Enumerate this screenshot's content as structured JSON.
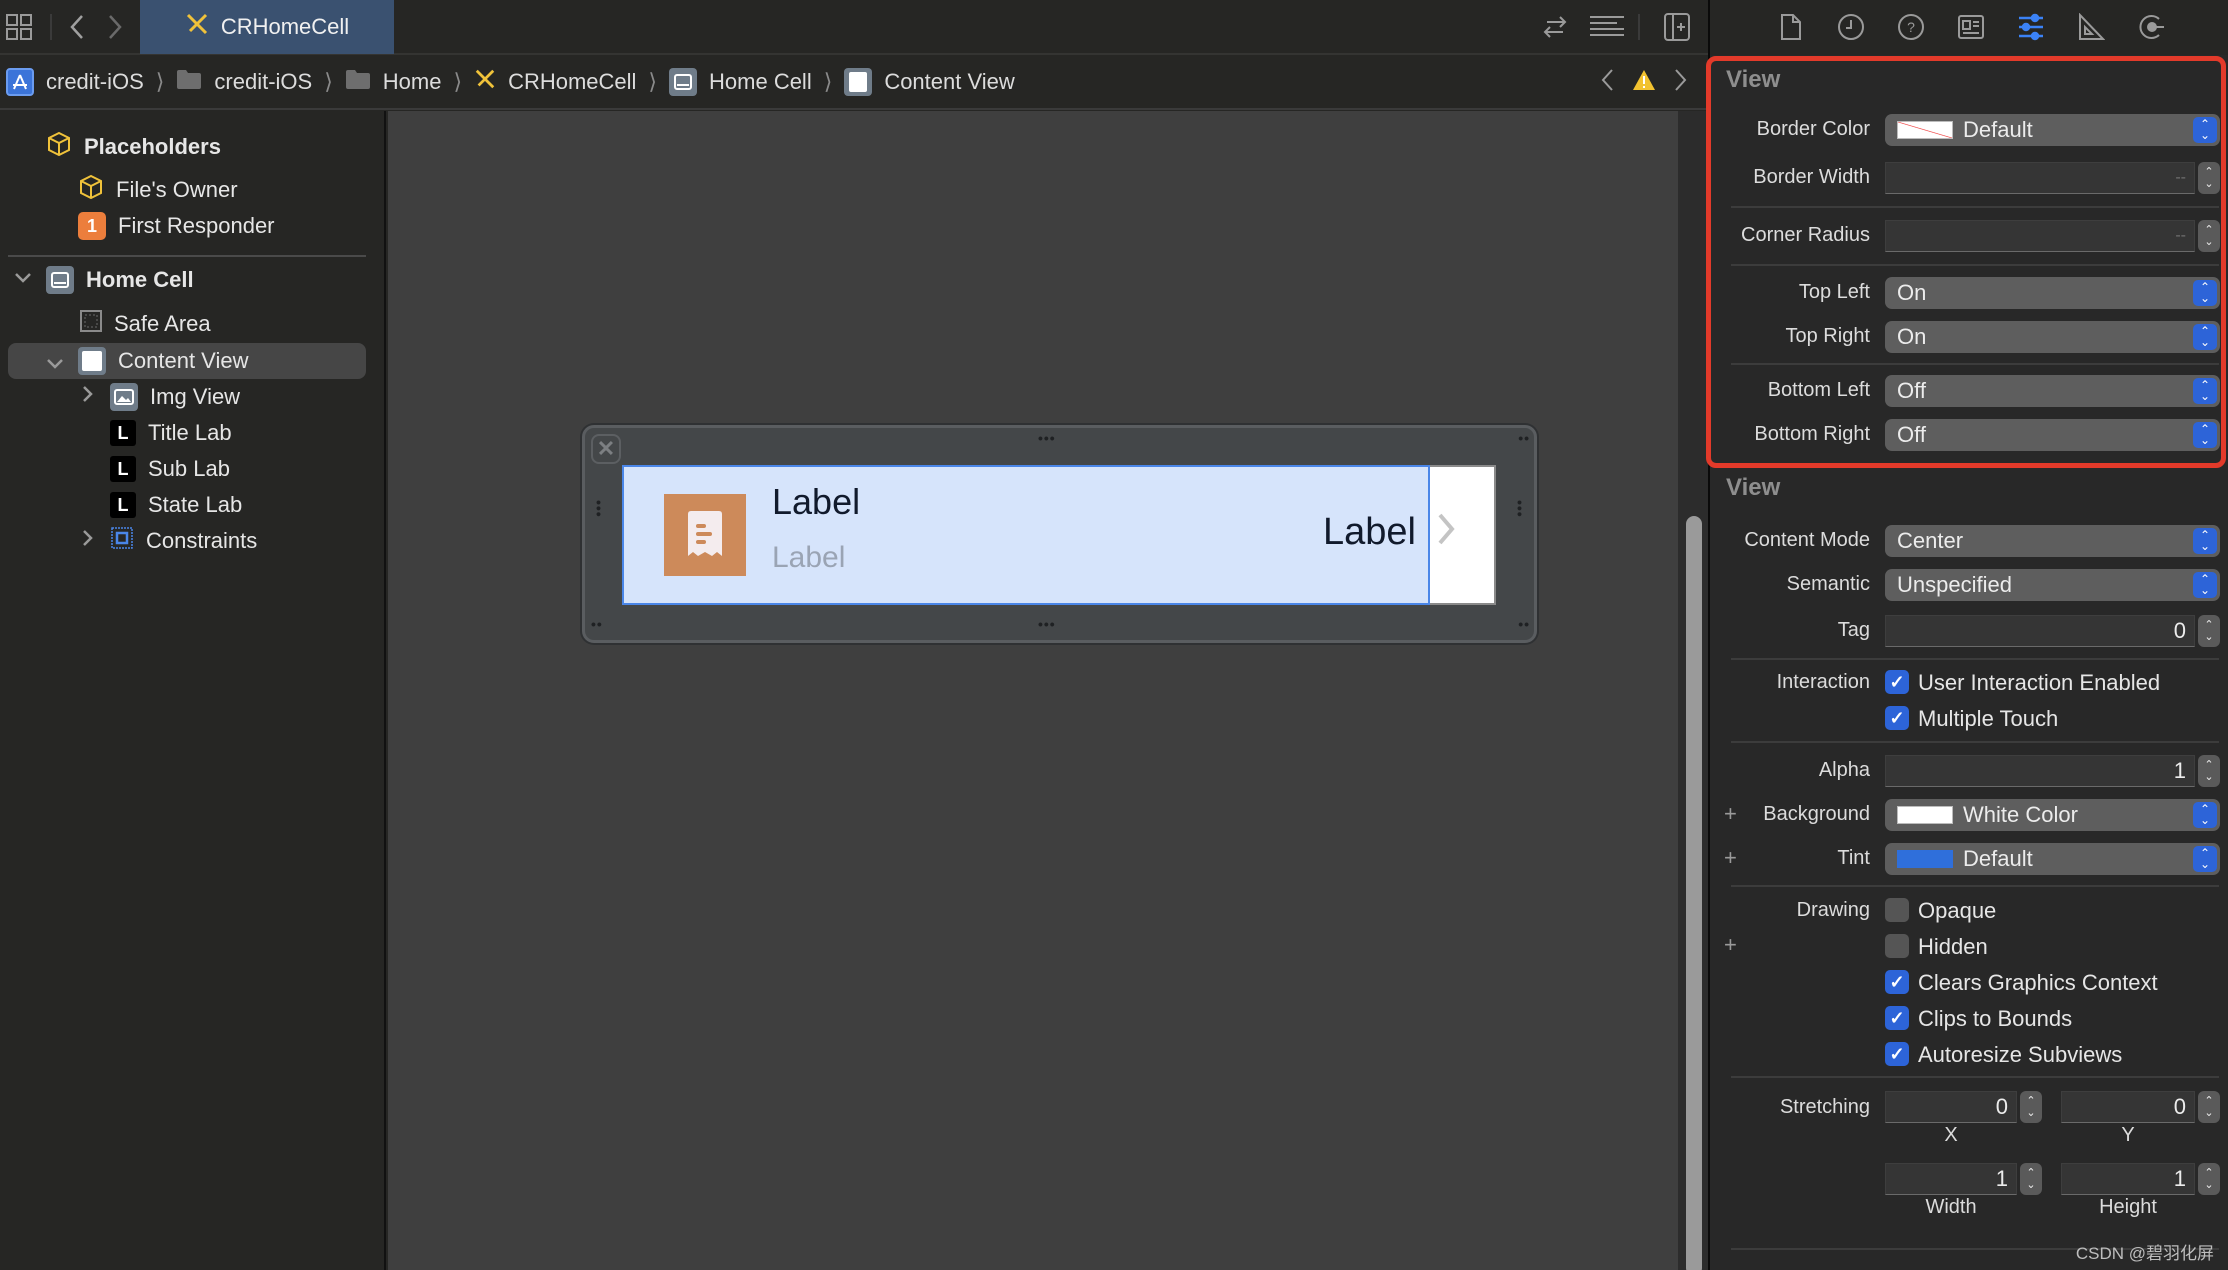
{
  "toolbar": {
    "active_tab": "CRHomeCell",
    "icons": [
      "grid-icon",
      "back-arrow-icon",
      "forward-arrow-icon",
      "swap-icon",
      "lines-icon",
      "add-editor-icon"
    ]
  },
  "breadcrumb": {
    "items": [
      {
        "label": "credit-iOS",
        "icon": "app-icon"
      },
      {
        "label": "credit-iOS",
        "icon": "folder-icon"
      },
      {
        "label": "Home",
        "icon": "folder-icon"
      },
      {
        "label": "CRHomeCell",
        "icon": "xib-icon"
      },
      {
        "label": "Home Cell",
        "icon": "table-cell-icon"
      },
      {
        "label": "Content View",
        "icon": "view-icon"
      }
    ],
    "warning_icon": "warning-icon"
  },
  "outline": {
    "placeholders_label": "Placeholders",
    "files_owner": "File's Owner",
    "first_responder": "First Responder",
    "first_responder_badge": "1",
    "home_cell": "Home Cell",
    "safe_area": "Safe Area",
    "content_view": "Content View",
    "img_view": "Img View",
    "title_lab": "Title Lab",
    "sub_lab": "Sub Lab",
    "state_lab": "State Lab",
    "constraints": "Constraints",
    "label_icon_glyph": "L"
  },
  "canvas": {
    "cell_title": "Label",
    "cell_subtitle": "Label",
    "cell_state": "Label",
    "colors": {
      "content_bg": "#d6e4fb",
      "image_bg": "#cd8a5a",
      "selection": "#4a86e8"
    }
  },
  "inspector": {
    "tabs": [
      "file-icon",
      "history-icon",
      "help-icon",
      "identity-icon",
      "attributes-icon",
      "size-icon",
      "connections-icon"
    ],
    "active_tab": "attributes-icon",
    "section1": {
      "title": "View",
      "border_color_label": "Border Color",
      "border_color_value": "Default",
      "border_width_label": "Border Width",
      "border_width_value": "--",
      "corner_radius_label": "Corner Radius",
      "corner_radius_value": "--",
      "top_left_label": "Top Left",
      "top_left_value": "On",
      "top_right_label": "Top Right",
      "top_right_value": "On",
      "bottom_left_label": "Bottom Left",
      "bottom_left_value": "Off",
      "bottom_right_label": "Bottom Right",
      "bottom_right_value": "Off"
    },
    "section2": {
      "title": "View",
      "content_mode_label": "Content Mode",
      "content_mode_value": "Center",
      "semantic_label": "Semantic",
      "semantic_value": "Unspecified",
      "tag_label": "Tag",
      "tag_value": "0",
      "interaction_label": "Interaction",
      "user_interaction_label": "User Interaction Enabled",
      "user_interaction_checked": true,
      "multiple_touch_label": "Multiple Touch",
      "multiple_touch_checked": true,
      "alpha_label": "Alpha",
      "alpha_value": "1",
      "background_label": "Background",
      "background_value": "White Color",
      "background_color": "#ffffff",
      "tint_label": "Tint",
      "tint_value": "Default",
      "tint_color": "#2f6fdb",
      "drawing_label": "Drawing",
      "opaque_label": "Opaque",
      "opaque_checked": false,
      "hidden_label": "Hidden",
      "hidden_checked": false,
      "clears_label": "Clears Graphics Context",
      "clears_checked": true,
      "clips_label": "Clips to Bounds",
      "clips_checked": true,
      "autoresize_label": "Autoresize Subviews",
      "autoresize_checked": true,
      "stretching_label": "Stretching",
      "stretch_x": "0",
      "stretch_y": "0",
      "stretch_width": "1",
      "stretch_height": "1",
      "x_label": "X",
      "y_label": "Y",
      "width_label": "Width",
      "height_label": "Height"
    },
    "highlight_color": "#e33a2a"
  },
  "watermark": "CSDN @碧羽化屏"
}
